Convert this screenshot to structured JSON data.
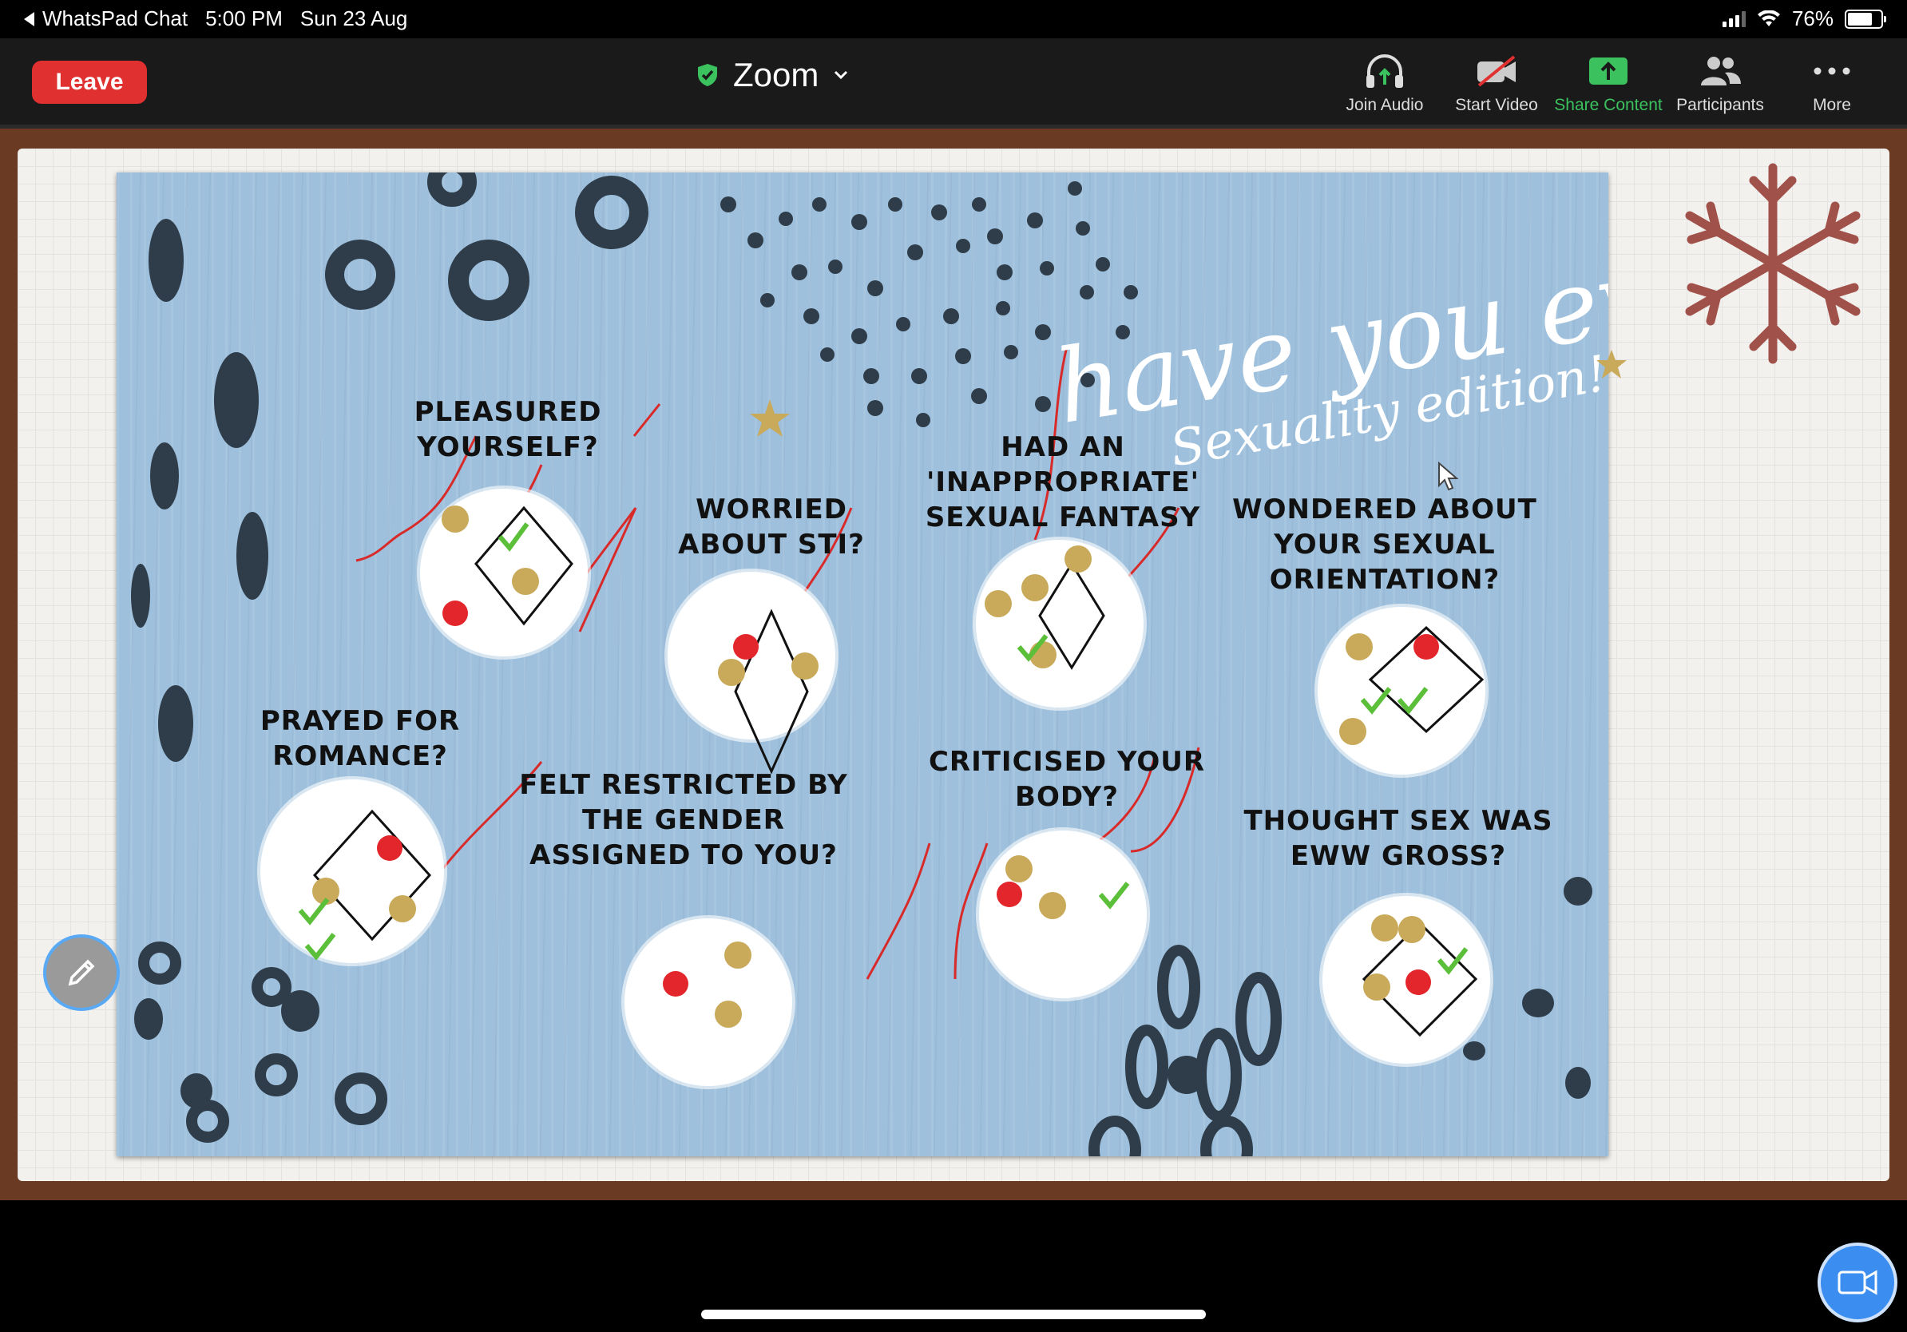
{
  "status_bar": {
    "back_app": "WhatsPad Chat",
    "time": "5:00 PM",
    "date": "Sun 23 Aug",
    "battery": "76%",
    "battery_level": 0.76
  },
  "toolbar": {
    "leave_label": "Leave",
    "meeting_title": "Zoom",
    "tools": [
      {
        "label": "Join Audio",
        "icon": "headphones-icon"
      },
      {
        "label": "Start Video",
        "icon": "video-off-icon"
      },
      {
        "label": "Share Content",
        "icon": "share-icon"
      },
      {
        "label": "Participants",
        "icon": "participants-icon"
      },
      {
        "label": "More",
        "icon": "more-icon"
      }
    ]
  },
  "slide": {
    "title": "have you ever?",
    "subtitle": "Sexuality edition!",
    "questions": [
      "PLEASURED\nYOURSELF?",
      "WORRIED\nABOUT STI?",
      "HAD AN\n'INAPPROPRIATE'\nSEXUAL FANTASY",
      "WONDERED ABOUT\nYOUR SEXUAL\nORIENTATION?",
      "PRAYED FOR\nROMANCE?",
      "FELT RESTRICTED BY\nTHE GENDER\nASSIGNED TO YOU?",
      "CRITICISED YOUR\nBODY?",
      "THOUGHT SEX WAS\nEWW GROSS?"
    ]
  },
  "colors": {
    "leave": "#e0302f",
    "share_green": "#3bc25f",
    "slide_bg": "#9ec0dc",
    "star": "#c9a95a",
    "heart": "#e2262b",
    "check": "#5cbf3a",
    "pen": "#d92a2a",
    "snowflake": "#a0514a"
  }
}
